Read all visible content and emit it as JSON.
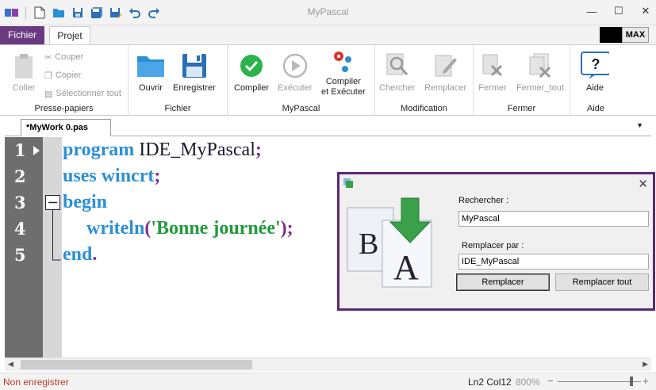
{
  "app": {
    "title": "MyPascal"
  },
  "ribbon_tabs": {
    "file": "Fichier",
    "projet": "Projet",
    "max": "MAX"
  },
  "groups": {
    "clipboard": {
      "label": "Presse-papiers",
      "coller": "Coller",
      "couper": "Couper",
      "copier": "Copier",
      "select_all": "Sélectionner tout"
    },
    "fichier": {
      "label": "Fichier",
      "ouvrir": "Ouvrir",
      "enregistrer": "Enregistrer"
    },
    "mypascal": {
      "label": "MyPascal",
      "compiler": "Compiler",
      "executer": "Exécuter",
      "compiler_executer_1": "Compiler",
      "compiler_executer_2": "et Exécuter"
    },
    "modification": {
      "label": "Modification",
      "chercher": "Chercher",
      "remplacer": "Remplacer"
    },
    "fermer": {
      "label": "Fermer",
      "fermer": "Fermer",
      "fermer_tout": "Fermer_tout"
    },
    "aide": {
      "label": "Aide",
      "aide": "Aide"
    }
  },
  "document": {
    "tab": "*MyWork 0.pas"
  },
  "code": {
    "line_numbers": [
      "1",
      "2",
      "3",
      "4",
      "5"
    ],
    "l1": {
      "kw": "program",
      "id": "IDE_MyPascal",
      "p": ";"
    },
    "l2": {
      "kw": "uses",
      "id": "wincrt",
      "p": ";"
    },
    "l3": {
      "kw": "begin"
    },
    "l4": {
      "kw": "writeln",
      "open": "(",
      "str": "'Bonne journée'",
      "close": ");"
    },
    "l5": {
      "kw": "end",
      "p": "."
    }
  },
  "status": {
    "saved": "Non enregistrer",
    "position": "Ln2 Col12",
    "zoom": "800%"
  },
  "replace_dialog": {
    "search_label": "Rechercher :",
    "search_value": "MyPascal",
    "replace_label": "Remplacer par :",
    "replace_value": "IDE_MyPascal",
    "replace_button": "Remplacer",
    "replace_all_button": "Remplacer tout"
  },
  "colors": {
    "accent": "#6b3b82",
    "keyword": "#2b8fd6",
    "string": "#1d9b3a",
    "punct": "#7b2d8e"
  }
}
